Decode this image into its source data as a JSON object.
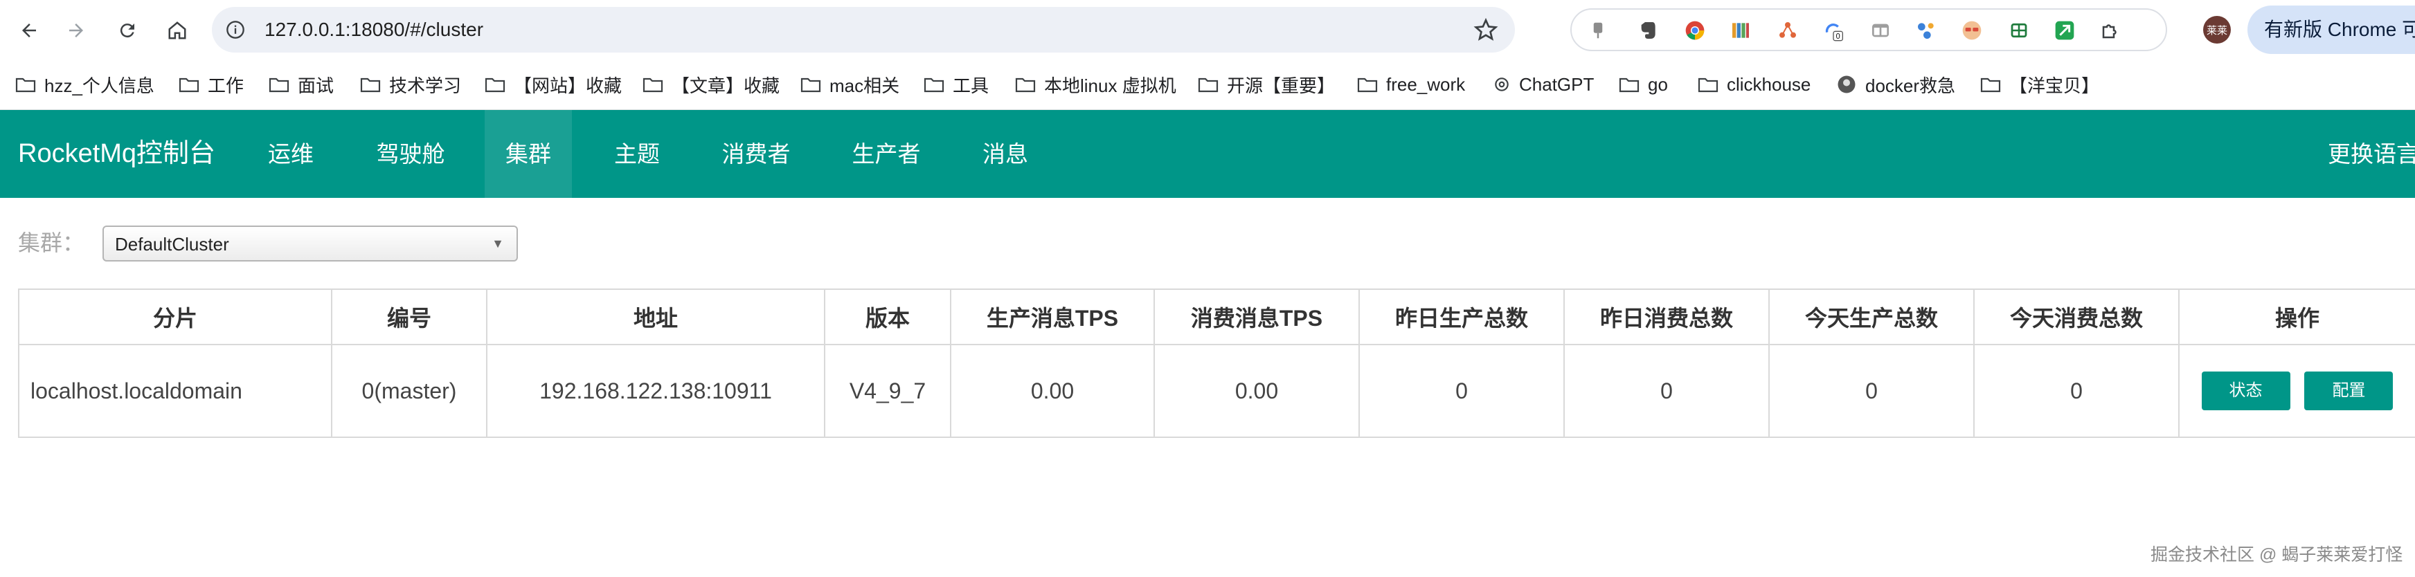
{
  "browser": {
    "url": "127.0.0.1:18080/#/cluster",
    "profile_initials": "莱莱",
    "update_label": "有新版 Chrome 可用",
    "extensions": [
      "pin-icon",
      "evernote-icon",
      "chrome-logo-icon",
      "books-icon",
      "network-icon",
      "sync-badge-icon",
      "tab-icon",
      "share-icon",
      "avatar-face-icon",
      "grid-icon",
      "arrow-app-icon",
      "puzzle-icon"
    ],
    "sync_badge_count": "0",
    "bookmarks": [
      {
        "label": "hzz_个人信息",
        "icon": "folder-icon"
      },
      {
        "label": "工作",
        "icon": "folder-icon"
      },
      {
        "label": "面试",
        "icon": "folder-icon"
      },
      {
        "label": "技术学习",
        "icon": "folder-icon"
      },
      {
        "label": "【网站】收藏",
        "icon": "folder-icon"
      },
      {
        "label": "【文章】收藏",
        "icon": "folder-icon"
      },
      {
        "label": "mac相关",
        "icon": "folder-icon"
      },
      {
        "label": "工具",
        "icon": "folder-icon"
      },
      {
        "label": "本地linux 虚拟机",
        "icon": "folder-icon"
      },
      {
        "label": "开源【重要】",
        "icon": "folder-icon"
      },
      {
        "label": "free_work",
        "icon": "folder-icon"
      },
      {
        "label": "ChatGPT",
        "icon": "openai-icon"
      },
      {
        "label": "go",
        "icon": "folder-icon"
      },
      {
        "label": "clickhouse",
        "icon": "folder-icon"
      },
      {
        "label": "docker救急",
        "icon": "avatar-icon"
      },
      {
        "label": "【洋宝贝】",
        "icon": "folder-icon"
      }
    ]
  },
  "app": {
    "brand": "RocketMq控制台",
    "nav": [
      {
        "label": "运维",
        "active": false
      },
      {
        "label": "驾驶舱",
        "active": false
      },
      {
        "label": "集群",
        "active": true
      },
      {
        "label": "主题",
        "active": false
      },
      {
        "label": "消费者",
        "active": false
      },
      {
        "label": "生产者",
        "active": false
      },
      {
        "label": "消息",
        "active": false
      }
    ],
    "language_label": "更换语言"
  },
  "filter": {
    "label": "集群：",
    "selected": "DefaultCluster"
  },
  "table": {
    "headers": [
      "分片",
      "编号",
      "地址",
      "版本",
      "生产消息TPS",
      "消费消息TPS",
      "昨日生产总数",
      "昨日消费总数",
      "今天生产总数",
      "今天消费总数",
      "操作"
    ],
    "rows": [
      {
        "shard": "localhost.localdomain",
        "id": "0(master)",
        "address": "192.168.122.138:10911",
        "version": "V4_9_7",
        "produce_tps": "0.00",
        "consume_tps": "0.00",
        "yesterday_produce": "0",
        "yesterday_consume": "0",
        "today_produce": "0",
        "today_consume": "0",
        "actions": [
          "状态",
          "配置"
        ]
      }
    ]
  },
  "watermark": "掘金技术社区 @ 蝎子莱莱爱打怪",
  "colors": {
    "accent": "#009688",
    "accent_active": "#1aa094"
  }
}
